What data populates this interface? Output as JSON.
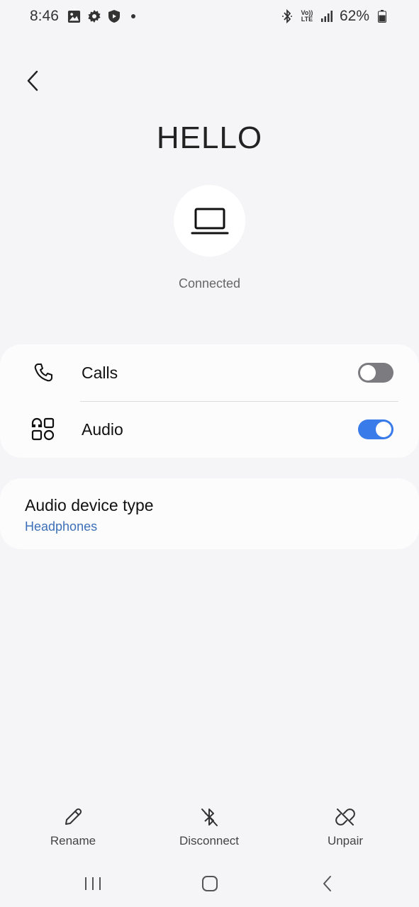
{
  "status_bar": {
    "time": "8:46",
    "network": "VoLTE",
    "volte_top": "Vo))",
    "volte_bottom": "LTE",
    "battery": "62%",
    "icons_left": [
      "gallery-icon",
      "settings-icon",
      "shield-icon",
      "notification-dot"
    ],
    "icons_right": [
      "bluetooth-icon",
      "volte-icon",
      "signal-icon",
      "battery-icon"
    ]
  },
  "header": {
    "device_name": "HELLO",
    "device_icon": "laptop-icon",
    "connection_status": "Connected"
  },
  "profiles": [
    {
      "label": "Calls",
      "icon": "phone-icon",
      "enabled": false
    },
    {
      "label": "Audio",
      "icon": "apps-icon",
      "enabled": true
    }
  ],
  "audio_device_type": {
    "title": "Audio device type",
    "value": "Headphones"
  },
  "actions": {
    "rename": "Rename",
    "disconnect": "Disconnect",
    "unpair": "Unpair"
  },
  "colors": {
    "background": "#f5f5f7",
    "card": "#fcfcfd",
    "accent": "#3a7bea",
    "link": "#3d6fb8",
    "toggle_off": "#7b7b80"
  }
}
